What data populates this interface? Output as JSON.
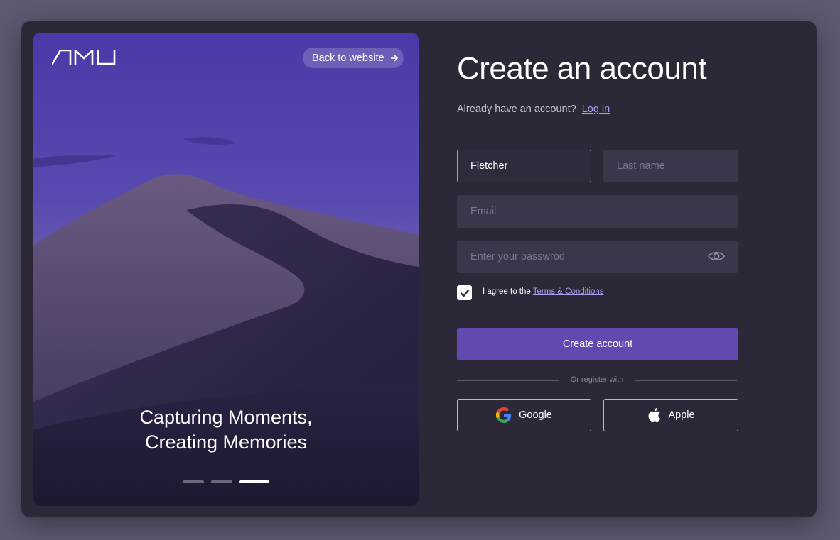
{
  "hero": {
    "logo_text": "AMU",
    "back_label": "Back to website",
    "tagline_line1": "Capturing Moments,",
    "tagline_line2": "Creating Memories",
    "carousel_total": 3,
    "carousel_active": 3
  },
  "form": {
    "title": "Create an account",
    "have_account_text": "Already have an account?",
    "login_link": "Log in",
    "first_name_value": "Fletcher",
    "last_name_placeholder": "Last name",
    "email_placeholder": "Email",
    "password_placeholder": "Enter your passwrod",
    "terms_checked": true,
    "agree_text": "I agree to the",
    "terms_link": "Terms & Conditions",
    "submit_label": "Create account",
    "divider_text": "Or register with",
    "google_label": "Google",
    "apple_label": "Apple"
  },
  "icons": {
    "password_toggle": "eye-icon",
    "back_arrow": "arrow-right-icon",
    "checkbox": "check-icon",
    "google": "google-icon",
    "apple": "apple-icon"
  },
  "colors": {
    "card_bg": "#2c2838",
    "accent": "#6249b0",
    "link": "#a99ef0",
    "field_bg": "#3b3649"
  }
}
